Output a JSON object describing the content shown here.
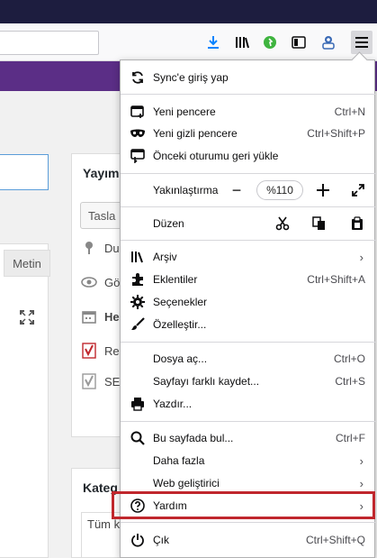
{
  "browser": {
    "toolbar_icons": [
      "download-icon",
      "library-icon",
      "extension-icon",
      "sidebar-icon",
      "account-icon",
      "hamburger-menu-icon"
    ]
  },
  "page": {
    "tab_metin": "Metin",
    "side_title": "Yayım",
    "side_select": "Tasla",
    "side_rows": [
      "Du",
      "Gö",
      "He",
      "Rea",
      "SEC"
    ],
    "category_title": "Kateg",
    "category_box": "Tüm k"
  },
  "menu": {
    "sync": "Sync'e giriş yap",
    "new_window": {
      "label": "Yeni pencere",
      "shortcut": "Ctrl+N"
    },
    "private_window": {
      "label": "Yeni gizli pencere",
      "shortcut": "Ctrl+Shift+P"
    },
    "restore_session": "Önceki oturumu geri yükle",
    "zoom": {
      "label": "Yakınlaştırma",
      "minus": "−",
      "value": "%110",
      "plus": "+"
    },
    "edit": {
      "label": "Düzen"
    },
    "library": "Arşiv",
    "addons": {
      "label": "Eklentiler",
      "shortcut": "Ctrl+Shift+A"
    },
    "options": "Seçenekler",
    "customize": "Özelleştir...",
    "open_file": {
      "label": "Dosya aç...",
      "shortcut": "Ctrl+O"
    },
    "save_page": {
      "label": "Sayfayı farklı kaydet...",
      "shortcut": "Ctrl+S"
    },
    "print": "Yazdır...",
    "find": {
      "label": "Bu sayfada bul...",
      "shortcut": "Ctrl+F"
    },
    "more": "Daha fazla",
    "web_dev": "Web geliştirici",
    "help": "Yardım",
    "quit": {
      "label": "Çık",
      "shortcut": "Ctrl+Shift+Q"
    },
    "submenu_arrow": "›"
  },
  "colors": {
    "highlight": "#c0272d",
    "purple_bar": "#5b2e86",
    "top_bar": "#1d1d3f"
  }
}
